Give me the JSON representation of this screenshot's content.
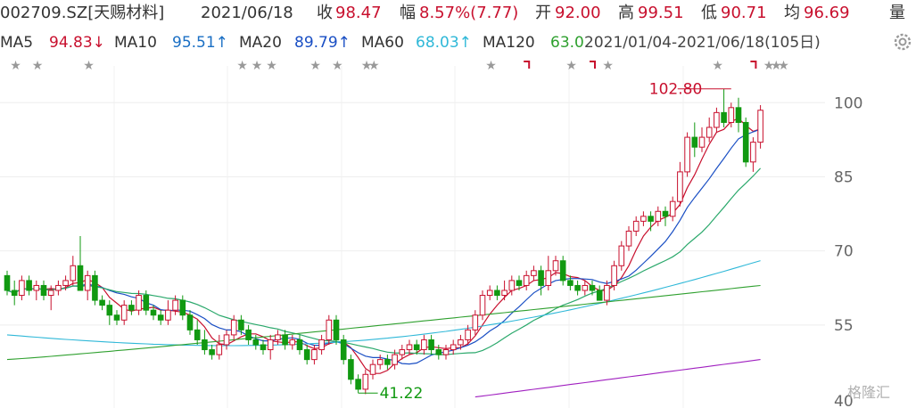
{
  "header": {
    "code_name": "002709.SZ[天赐材料]",
    "date": "2021/06/18",
    "close_label": "收",
    "close_value": "98.47",
    "change_label": "幅",
    "change_value": "8.57%(7.77)",
    "open_label": "开",
    "open_value": "92.00",
    "high_label": "高",
    "high_value": "99.51",
    "low_label": "低",
    "low_value": "90.71",
    "avg_label": "均",
    "avg_value": "96.69",
    "volume_label": "量"
  },
  "ma_legend": {
    "ma5_label": "MA5",
    "ma5_value": "94.83↓",
    "ma10_label": "MA10",
    "ma10_value": "95.51↑",
    "ma20_label": "MA20",
    "ma20_value": "89.79↑",
    "ma60_label": "MA60",
    "ma60_value": "68.03↑",
    "ma120_label": "MA120",
    "ma120_value": "63.0",
    "range_text": "2021/01/04-2021/06/18(105日)",
    "colors": {
      "ma5": "#c8102e",
      "ma10": "#1a4fc4",
      "ma20": "#2aa86b",
      "ma60": "#2fb8d8",
      "ma120": "#2fa02f",
      "ma250": "#a020c0"
    }
  },
  "settings_icon": "gear-icon",
  "watermark_text": "格隆汇",
  "chart_data": {
    "type": "candlestick",
    "ylim": [
      40,
      106
    ],
    "yticks": [
      100,
      85,
      70,
      55
    ],
    "yticks_partial": [
      "40"
    ],
    "up_color": "#c8102e",
    "down_color": "#119911",
    "annotations": [
      {
        "label": "102.80",
        "index": 99,
        "price": 102.8,
        "color": "#c8102e"
      },
      {
        "label": "41.22",
        "index": 48,
        "price": 41.22,
        "color": "#119911"
      }
    ],
    "event_markers": [
      {
        "index": 1,
        "mark": "star"
      },
      {
        "index": 4,
        "mark": "star"
      },
      {
        "index": 11,
        "mark": "star"
      },
      {
        "index": 32,
        "mark": "star"
      },
      {
        "index": 34,
        "mark": "star"
      },
      {
        "index": 36,
        "mark": "star"
      },
      {
        "index": 42,
        "mark": "star"
      },
      {
        "index": 45,
        "mark": "star"
      },
      {
        "index": 49,
        "mark": "star"
      },
      {
        "index": 50,
        "mark": "star"
      },
      {
        "index": 66,
        "mark": "star"
      },
      {
        "index": 71,
        "mark": "flag"
      },
      {
        "index": 77,
        "mark": "star"
      },
      {
        "index": 80,
        "mark": "flag"
      },
      {
        "index": 82,
        "mark": "star"
      },
      {
        "index": 97,
        "mark": "star"
      },
      {
        "index": 102,
        "mark": "flag"
      },
      {
        "index": 104,
        "mark": "star"
      },
      {
        "index": 105,
        "mark": "star"
      },
      {
        "index": 106,
        "mark": "star"
      }
    ],
    "candles": [
      [
        65,
        62,
        66,
        61
      ],
      [
        62,
        61,
        64,
        59
      ],
      [
        61,
        64,
        65,
        60
      ],
      [
        64,
        62,
        65,
        61
      ],
      [
        62,
        63,
        64,
        60
      ],
      [
        63,
        61,
        64,
        60
      ],
      [
        61,
        62,
        63,
        58
      ],
      [
        62,
        63,
        64,
        61
      ],
      [
        63,
        64,
        65,
        62
      ],
      [
        64,
        67,
        69,
        63
      ],
      [
        67,
        62,
        73,
        62
      ],
      [
        62,
        65,
        66,
        60
      ],
      [
        65,
        60,
        66,
        59
      ],
      [
        60,
        59,
        61,
        58
      ],
      [
        59,
        57,
        60,
        55
      ],
      [
        57,
        56,
        58,
        55
      ],
      [
        56,
        59,
        60,
        55
      ],
      [
        59,
        58,
        60,
        57
      ],
      [
        58,
        61,
        62,
        57
      ],
      [
        61,
        58,
        62,
        57
      ],
      [
        58,
        57,
        59,
        56
      ],
      [
        57,
        56,
        58,
        55
      ],
      [
        56,
        58,
        60,
        55
      ],
      [
        58,
        60,
        61,
        57
      ],
      [
        60,
        57,
        61,
        56
      ],
      [
        57,
        54,
        58,
        53
      ],
      [
        54,
        52,
        56,
        51
      ],
      [
        52,
        50,
        54,
        49
      ],
      [
        50,
        49,
        51,
        48
      ],
      [
        49,
        51,
        53,
        48
      ],
      [
        51,
        53,
        54,
        50
      ],
      [
        53,
        56,
        57,
        52
      ],
      [
        56,
        54,
        57,
        53
      ],
      [
        54,
        52,
        55,
        51
      ],
      [
        52,
        51,
        53,
        50
      ],
      [
        51,
        50,
        52,
        49
      ],
      [
        50,
        52,
        53,
        48
      ],
      [
        52,
        53,
        54,
        51
      ],
      [
        53,
        51,
        54,
        50
      ],
      [
        51,
        52,
        53,
        50
      ],
      [
        52,
        50,
        53,
        49
      ],
      [
        50,
        48,
        51,
        47
      ],
      [
        48,
        50,
        51,
        47
      ],
      [
        50,
        52,
        53,
        49
      ],
      [
        52,
        56,
        57,
        51
      ],
      [
        56,
        52,
        57,
        51
      ],
      [
        52,
        48,
        53,
        47
      ],
      [
        48,
        44,
        49,
        43
      ],
      [
        44,
        42,
        45,
        41.22
      ],
      [
        42,
        45,
        46,
        41
      ],
      [
        45,
        47,
        48,
        44
      ],
      [
        47,
        48,
        49,
        46
      ],
      [
        48,
        47,
        49,
        46
      ],
      [
        47,
        49,
        50,
        46
      ],
      [
        49,
        50,
        51,
        48
      ],
      [
        50,
        51,
        52,
        49
      ],
      [
        51,
        50,
        52,
        49
      ],
      [
        50,
        52,
        53,
        49
      ],
      [
        52,
        50,
        53,
        49
      ],
      [
        50,
        49,
        51,
        48
      ],
      [
        49,
        50,
        51,
        48
      ],
      [
        50,
        51,
        52,
        49
      ],
      [
        51,
        52,
        53,
        50
      ],
      [
        52,
        54,
        55,
        51
      ],
      [
        54,
        57,
        58,
        53
      ],
      [
        57,
        61,
        62,
        56
      ],
      [
        61,
        62,
        63,
        60
      ],
      [
        62,
        61,
        63,
        60
      ],
      [
        61,
        62,
        64,
        60
      ],
      [
        62,
        64,
        65,
        61
      ],
      [
        64,
        63,
        65,
        62
      ],
      [
        63,
        65,
        66,
        62
      ],
      [
        65,
        66,
        67,
        64
      ],
      [
        66,
        63,
        67,
        61
      ],
      [
        63,
        66,
        69,
        62
      ],
      [
        66,
        68,
        69,
        65
      ],
      [
        68,
        64,
        69,
        63
      ],
      [
        64,
        63,
        65,
        62
      ],
      [
        63,
        62,
        64,
        61
      ],
      [
        62,
        63,
        64,
        61
      ],
      [
        63,
        62,
        64,
        61
      ],
      [
        62,
        60,
        63,
        60
      ],
      [
        60,
        63,
        64,
        59
      ],
      [
        63,
        67,
        68,
        62
      ],
      [
        67,
        71,
        72,
        66
      ],
      [
        71,
        74,
        75,
        70
      ],
      [
        74,
        76,
        77,
        73
      ],
      [
        76,
        77,
        78,
        75
      ],
      [
        77,
        76,
        78,
        74
      ],
      [
        76,
        78,
        79,
        75
      ],
      [
        78,
        77,
        79,
        75
      ],
      [
        77,
        80,
        81,
        76
      ],
      [
        80,
        86,
        88,
        79
      ],
      [
        86,
        93,
        94,
        85
      ],
      [
        93,
        91,
        96,
        89
      ],
      [
        91,
        93,
        95,
        90
      ],
      [
        93,
        95,
        97,
        92
      ],
      [
        95,
        98,
        99,
        94
      ],
      [
        98,
        96,
        102.8,
        95
      ],
      [
        96,
        99,
        100,
        95
      ],
      [
        99,
        96,
        101,
        94
      ],
      [
        96,
        88,
        97,
        87
      ],
      [
        88,
        92,
        93,
        86
      ],
      [
        92,
        98.47,
        99.51,
        90.71
      ]
    ],
    "ma_series": [
      {
        "id": "ma5",
        "start": 66,
        "end": 94.83
      },
      {
        "id": "ma10",
        "start": 64,
        "end": 95.51
      },
      {
        "id": "ma20",
        "start": 63,
        "end": 89.79
      },
      {
        "id": "ma60",
        "start": 53,
        "end": 68.03
      },
      {
        "id": "ma120",
        "start": 48,
        "end": 63.0
      },
      {
        "id": "ma250",
        "start": 28,
        "end": 48
      }
    ]
  }
}
